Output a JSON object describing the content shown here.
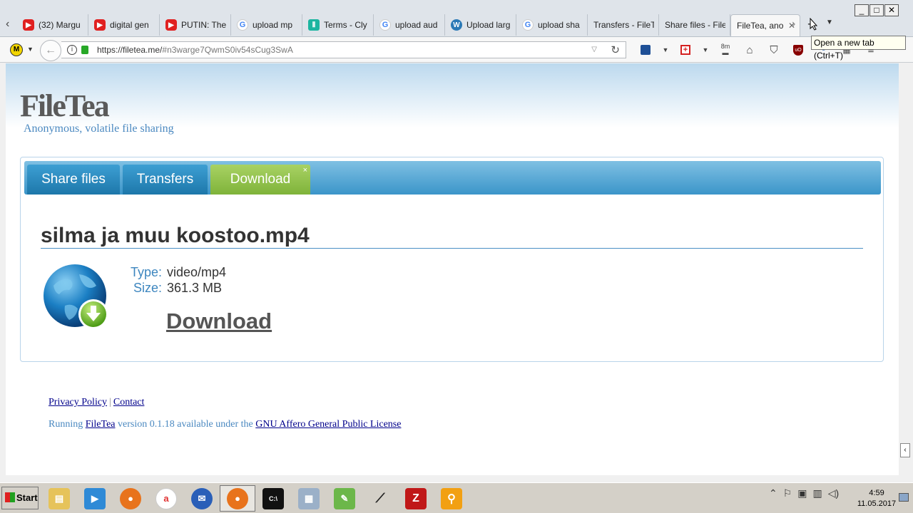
{
  "browser": {
    "tabs": [
      {
        "label": "(32) Margu",
        "icon": "youtube-icon"
      },
      {
        "label": "digital gen",
        "icon": "youtube-icon"
      },
      {
        "label": "PUTIN: The",
        "icon": "youtube-icon"
      },
      {
        "label": "upload mp",
        "icon": "google-icon"
      },
      {
        "label": "Terms - Cly",
        "icon": "clyp-icon"
      },
      {
        "label": "upload aud",
        "icon": "google-icon"
      },
      {
        "label": "Upload larg",
        "icon": "wordpress-icon"
      },
      {
        "label": "upload sha",
        "icon": "google-icon"
      },
      {
        "label": "Transfers - FileT",
        "icon": "none"
      },
      {
        "label": "Share files - File",
        "icon": "none"
      },
      {
        "label": "FileTea, ano",
        "icon": "none",
        "active": true
      }
    ],
    "newtab_tooltip": "Open a new tab (Ctrl+T)",
    "url_host": "https://filetea.me/",
    "url_rest": "#n3warge7QwmS0iv54sCug3SwA",
    "toolbar_badge": "8m",
    "window_controls": [
      "_",
      "□",
      "✕"
    ]
  },
  "page": {
    "logo": "FileTea",
    "tagline": "Anonymous, volatile file sharing",
    "tabs": {
      "share": "Share files",
      "transfers": "Transfers",
      "download": "Download",
      "download_close": "×"
    },
    "file": {
      "name": "silma ja muu koostoo.mp4",
      "type_label": "Type:",
      "type_value": "video/mp4",
      "size_label": "Size:",
      "size_value": "361.3 MB",
      "download_label": "Download"
    },
    "footer": {
      "privacy": "Privacy Policy",
      "separator": "|",
      "contact": "Contact",
      "running_prefix": "Running",
      "filetea_link": "FileTea",
      "version_text": "version 0.1.18 available under the",
      "license_link": "GNU Affero General Public License"
    },
    "accent_color": "#3b95c9",
    "active_tab_color": "#8cc04a"
  },
  "taskbar": {
    "start_label": "Start",
    "items": [
      "file-manager-icon",
      "media-player-icon",
      "firefox-icon",
      "arc-icon",
      "thunderbird-icon",
      "firefox-active-icon",
      "cmd-icon",
      "calculator-icon",
      "chart-editor-icon",
      "microphone-icon",
      "filezilla-icon",
      "search-tool-icon"
    ],
    "time": "4:59",
    "date": "11.05.2017"
  }
}
